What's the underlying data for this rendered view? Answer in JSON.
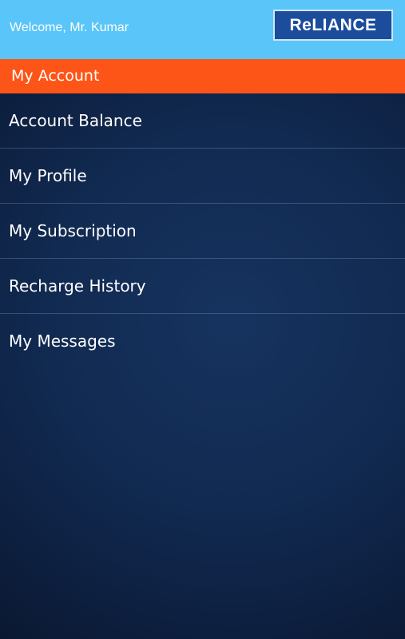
{
  "header": {
    "welcome_text": "Welcome, Mr. Kumar",
    "logo_text": "ReLIANCE",
    "background_color": "#5ac5f8"
  },
  "section": {
    "title": "My Account",
    "background_color": "#fd5517"
  },
  "menu": {
    "items": [
      {
        "label": "Account Balance"
      },
      {
        "label": "My Profile"
      },
      {
        "label": "My Subscription"
      },
      {
        "label": "Recharge History"
      },
      {
        "label": "My Messages"
      }
    ]
  }
}
